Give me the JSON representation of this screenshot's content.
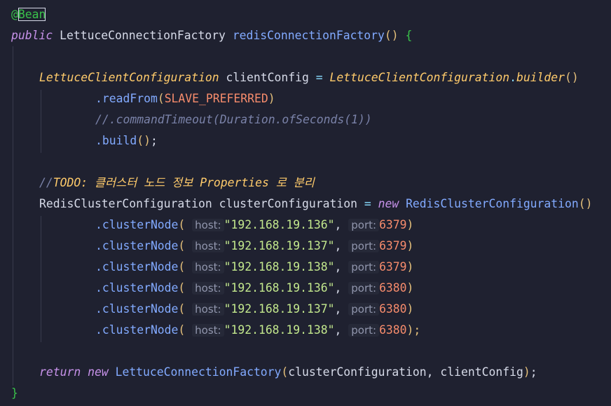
{
  "code": {
    "annotation": "@Bean",
    "method_decl": {
      "kw_public": "public",
      "return_type": "LettuceConnectionFactory",
      "method_name": "redisConnectionFactory",
      "parens": "()",
      "open_brace": "{"
    },
    "client_config": {
      "type": "LettuceClientConfiguration",
      "var": "clientConfig",
      "assign": "=",
      "builder_class": "LettuceClientConfiguration",
      "dot": ".",
      "builder_method": "builder",
      "parens": "()"
    },
    "read_from": {
      "method": ".readFrom",
      "open": "(",
      "arg": "SLAVE_PREFERRED",
      "close": ")"
    },
    "commented_timeout": "//.commandTimeout(Duration.ofSeconds(1))",
    "build_line": {
      "method": ".build",
      "parens": "()",
      "semi": ";"
    },
    "todo_comment": {
      "slashes": "//",
      "text": "TODO: 클러스터 노드 정보 Properties 로 분리"
    },
    "cluster_config": {
      "type": "RedisClusterConfiguration",
      "var": "clusterConfiguration",
      "assign": "=",
      "kw_new": "new",
      "class": "RedisClusterConfiguration",
      "parens": "()"
    },
    "cluster_nodes": [
      {
        "method": ".clusterNode",
        "host_hint": "host:",
        "host": "\"192.168.19.136\"",
        "port_hint": "port:",
        "port": "6379",
        "end": ")"
      },
      {
        "method": ".clusterNode",
        "host_hint": "host:",
        "host": "\"192.168.19.137\"",
        "port_hint": "port:",
        "port": "6379",
        "end": ")"
      },
      {
        "method": ".clusterNode",
        "host_hint": "host:",
        "host": "\"192.168.19.138\"",
        "port_hint": "port:",
        "port": "6379",
        "end": ")"
      },
      {
        "method": ".clusterNode",
        "host_hint": "host:",
        "host": "\"192.168.19.136\"",
        "port_hint": "port:",
        "port": "6380",
        "end": ")"
      },
      {
        "method": ".clusterNode",
        "host_hint": "host:",
        "host": "\"192.168.19.137\"",
        "port_hint": "port:",
        "port": "6380",
        "end": ")"
      },
      {
        "method": ".clusterNode",
        "host_hint": "host:",
        "host": "\"192.168.19.138\"",
        "port_hint": "port:",
        "port": "6380",
        "end": ");"
      }
    ],
    "return_line": {
      "kw_return": "return",
      "kw_new": "new",
      "class": "LettuceConnectionFactory",
      "open": "(",
      "args": "clusterConfiguration, clientConfig",
      "close": ")",
      "semi": ";"
    },
    "close_brace": "}"
  },
  "colors": {
    "background": "#1f2130",
    "keyword": "#c792ea",
    "type_italic": "#ffcb6b",
    "function": "#82aaff",
    "string": "#c3e88d",
    "number": "#f78c6c",
    "comment": "#7a82a8",
    "annotation": "#39c24a"
  }
}
